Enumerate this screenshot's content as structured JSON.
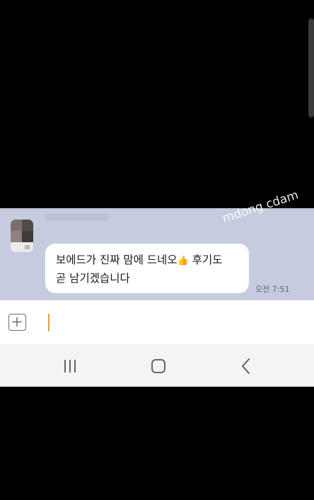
{
  "chat": {
    "sender_name": "",
    "message_line1": "보에드가 진짜 맘에 드네오",
    "message_emoji": "👍",
    "message_line1_end": " 후기도",
    "message_line2": "곧 남기겠습니다",
    "timestamp": "오전 7:51"
  },
  "watermark": {
    "text1": "mdong cdam",
    "text2": "dong cdam"
  },
  "input_bar": {
    "placeholder": ""
  },
  "navigation": {
    "recents_icon": "recents-icon",
    "home_icon": "home-icon",
    "back_icon": "back-icon"
  },
  "colors": {
    "chat_background": "#c6ccdf",
    "bubble": "#ffffff",
    "cursor": "#f0a020"
  }
}
